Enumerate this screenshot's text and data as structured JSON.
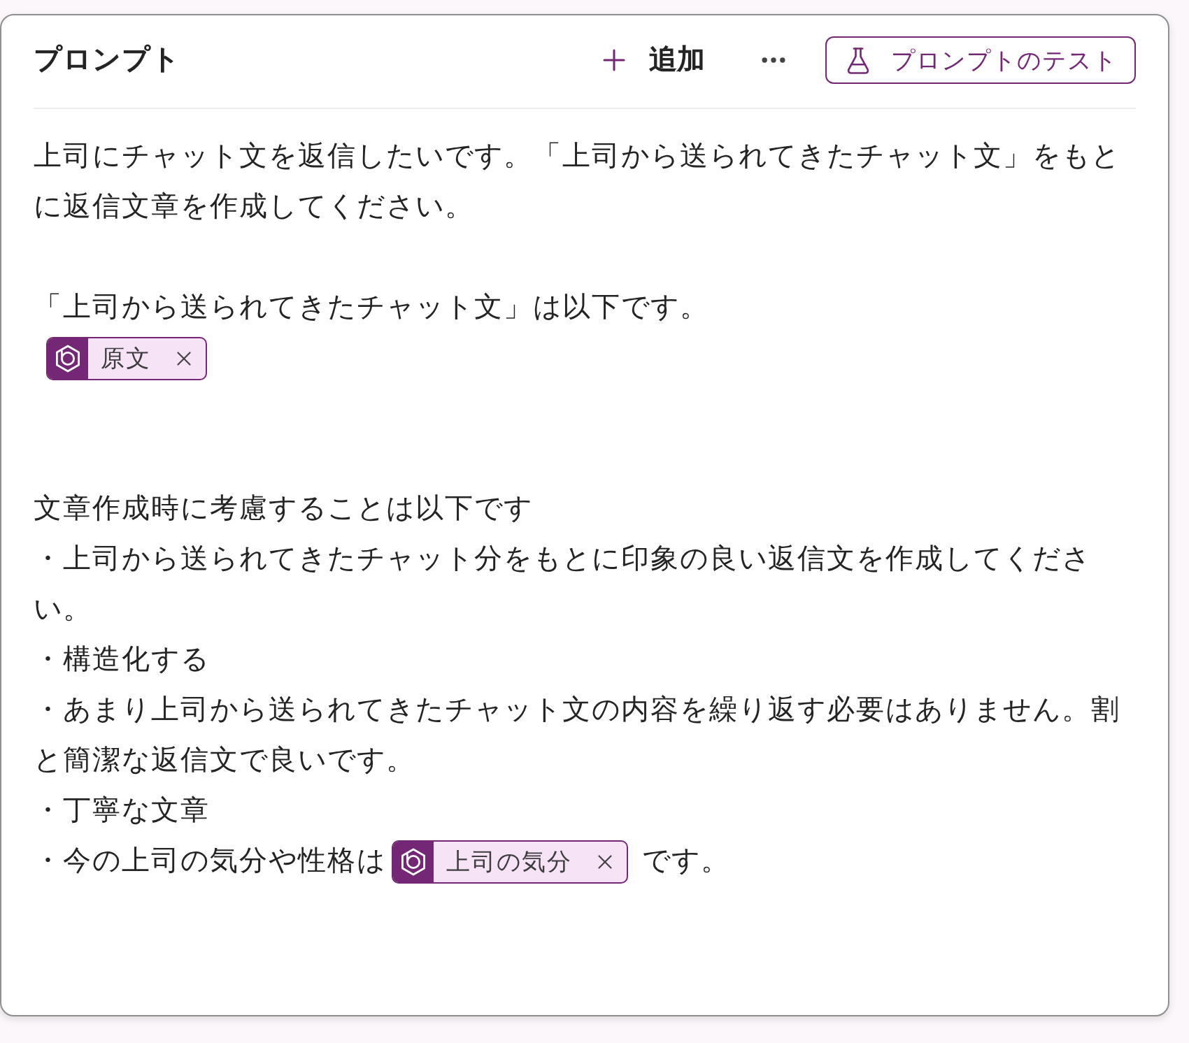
{
  "prompt_panel": {
    "title": "プロンプト",
    "add_button": {
      "label": "追加"
    },
    "test_button": {
      "label": "プロンプトのテスト"
    }
  },
  "prompt_body": [
    {
      "kind": "paragraph",
      "segments": [
        {
          "kind": "text",
          "text": "上司にチャット文を返信したいです。「上司から送られてきたチャット文」をもとに返信文章を作成してください。"
        }
      ]
    },
    {
      "kind": "blank"
    },
    {
      "kind": "paragraph",
      "segments": [
        {
          "kind": "text",
          "text": "「上司から送られてきたチャット文」は以下です。"
        }
      ]
    },
    {
      "kind": "paragraph",
      "segments": [
        {
          "kind": "chip",
          "label": "原文"
        }
      ]
    },
    {
      "kind": "blank"
    },
    {
      "kind": "blank"
    },
    {
      "kind": "paragraph",
      "segments": [
        {
          "kind": "text",
          "text": "文章作成時に考慮することは以下です"
        }
      ]
    },
    {
      "kind": "paragraph",
      "segments": [
        {
          "kind": "text",
          "text": "・上司から送られてきたチャット分をもとに印象の良い返信文を作成してください。"
        }
      ]
    },
    {
      "kind": "paragraph",
      "segments": [
        {
          "kind": "text",
          "text": "・構造化する"
        }
      ]
    },
    {
      "kind": "paragraph",
      "segments": [
        {
          "kind": "text",
          "text": "・あまり上司から送られてきたチャット文の内容を繰り返す必要はありません。割と簡潔な返信文で良いです。"
        }
      ]
    },
    {
      "kind": "paragraph",
      "segments": [
        {
          "kind": "text",
          "text": "・丁寧な文章"
        }
      ]
    },
    {
      "kind": "paragraph",
      "segments": [
        {
          "kind": "text",
          "text": "・今の上司の気分や性格は"
        },
        {
          "kind": "chip",
          "label": "上司の気分"
        },
        {
          "kind": "text",
          "text": "です。"
        }
      ]
    }
  ]
}
